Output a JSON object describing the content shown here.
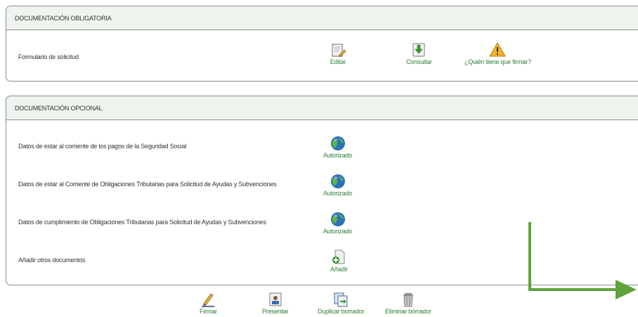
{
  "obligatoria": {
    "header": "DOCUMENTACIÓN OBLIGATORIA",
    "row_label": "Formulario de solicitud",
    "edit_label": "Editar",
    "consult_label": "Consultar",
    "who_sign_label": "¿Quién tiene que firmar?"
  },
  "opcional": {
    "header": "DOCUMENTACIÓN OPCIONAL",
    "rows": [
      {
        "label": "Datos de estar al corriente de los pagos de la Seguridad Social",
        "action": "Autorizado"
      },
      {
        "label": "Datos de estar al Corriente de Obligaciones Tributarias para Solicitud de Ayudas y Subvenciones",
        "action": "Autorizado"
      },
      {
        "label": "Datos de cumplimiento de Obligaciones Tributarias para Solicitud de Ayudas y Subvenciones",
        "action": "Autorizado"
      },
      {
        "label": "Añadir otros documentos",
        "action": "Añadir"
      }
    ]
  },
  "bottom": {
    "firmar": "Firmar",
    "presentar": "Presentar",
    "duplicar": "Duplicar borrador",
    "eliminar": "Eliminar borrador"
  },
  "colors": {
    "link_green": "#2d7c37",
    "header_bg": "#eef5ee",
    "arrow_green": "#5ea33d"
  }
}
